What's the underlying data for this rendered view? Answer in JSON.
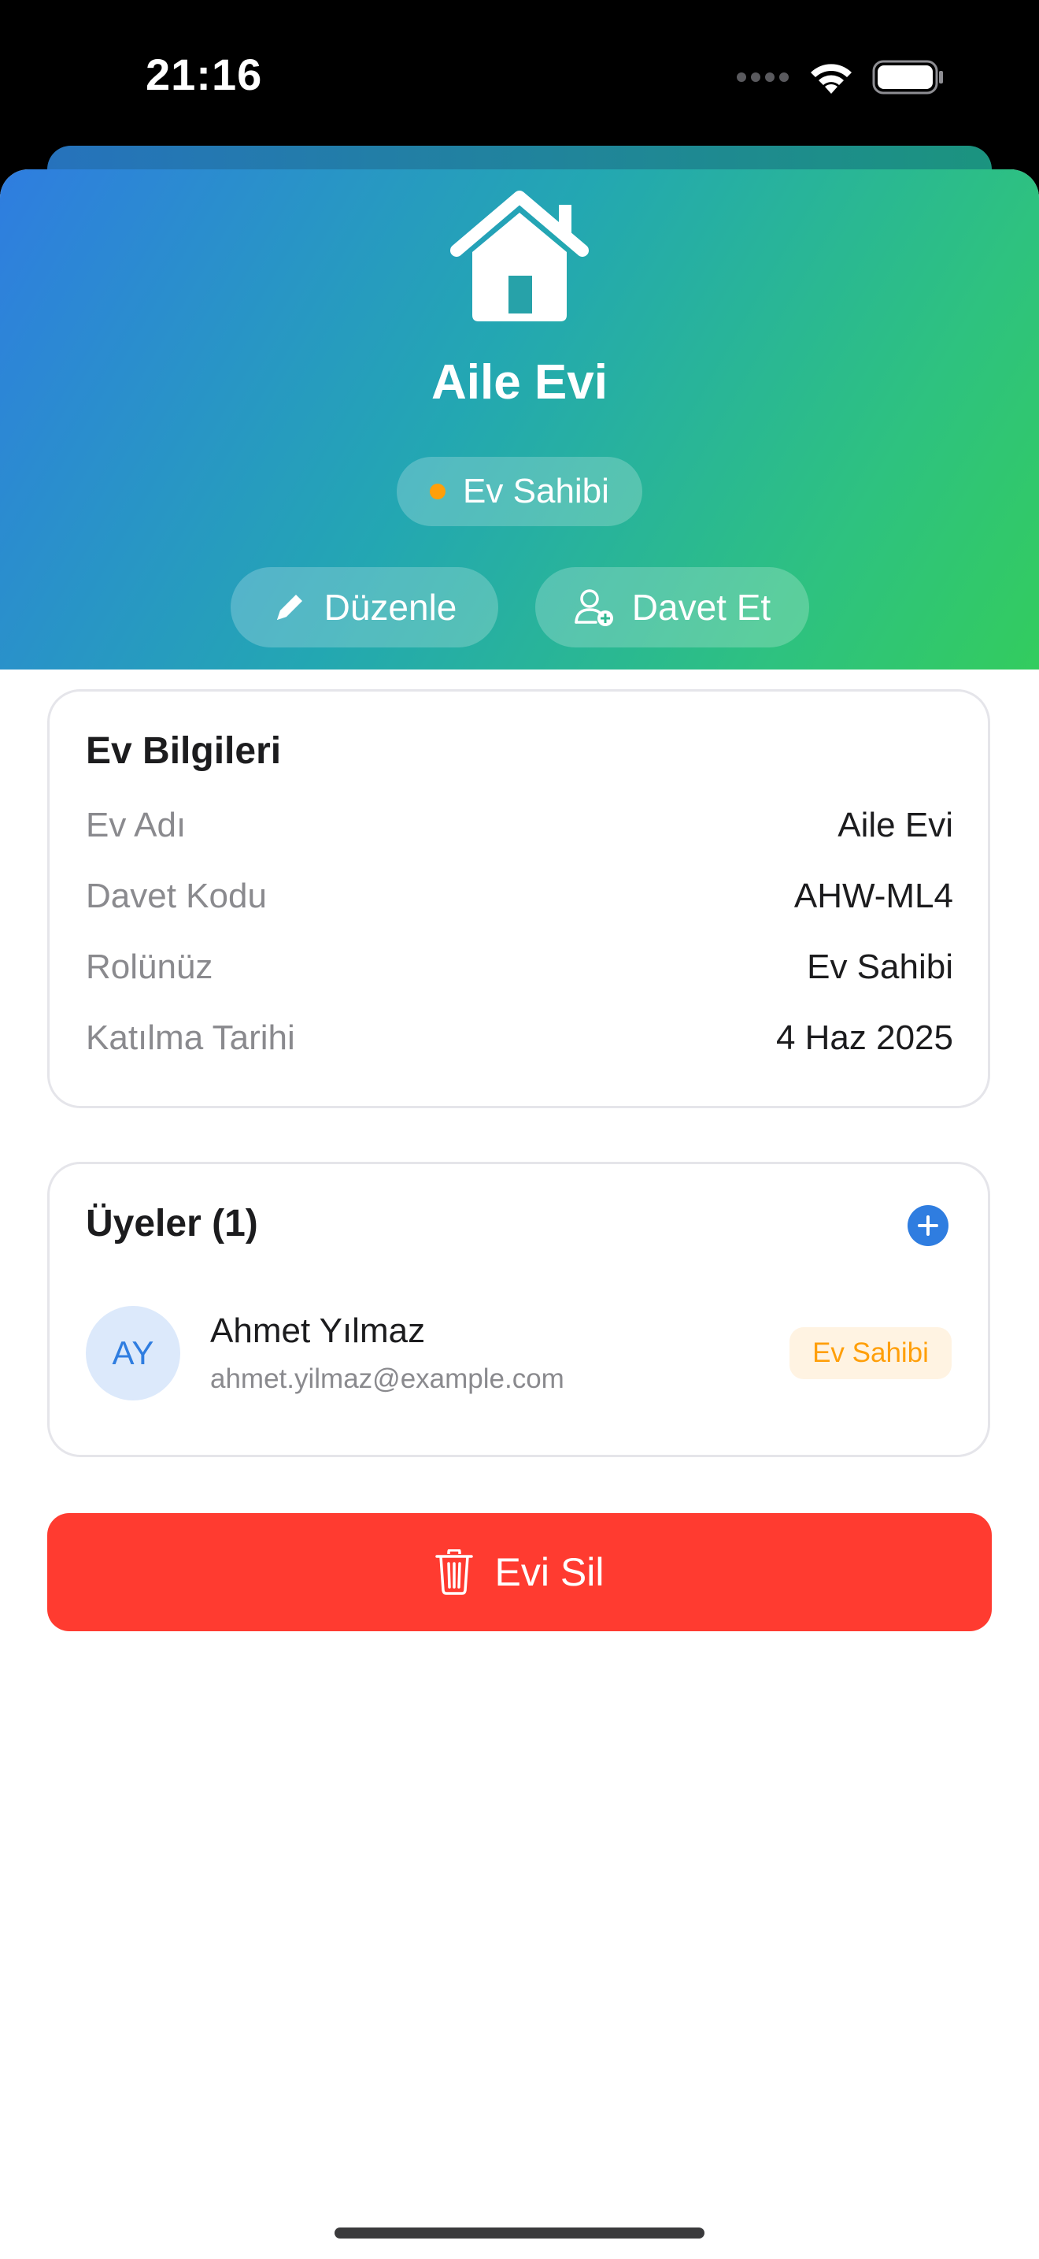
{
  "status_bar": {
    "time": "21:16"
  },
  "hero": {
    "icon": "house-icon",
    "title": "Aile Evi",
    "role_badge": "Ev Sahibi",
    "role_dot_color": "#ff9f0a",
    "edit_label": "Düzenle",
    "edit_icon": "pencil-icon",
    "invite_label": "Davet Et",
    "invite_icon": "person-add-icon"
  },
  "info_card": {
    "title": "Ev Bilgileri",
    "rows": [
      {
        "label": "Ev Adı",
        "value": "Aile Evi"
      },
      {
        "label": "Davet Kodu",
        "value": "AHW-ML4"
      },
      {
        "label": "Rolünüz",
        "value": "Ev Sahibi"
      },
      {
        "label": "Katılma Tarihi",
        "value": "4 Haz 2025"
      }
    ]
  },
  "members_card": {
    "title": "Üyeler (1)",
    "add_icon": "plus-circle-icon",
    "members": [
      {
        "initials": "AY",
        "name": "Ahmet Yılmaz",
        "email": "ahmet.yilmaz@example.com",
        "role": "Ev Sahibi"
      }
    ]
  },
  "delete_button": {
    "label": "Evi Sil",
    "icon": "trash-icon",
    "color": "#ff3b30"
  },
  "colors": {
    "accent": "#2f7de0",
    "gradient_start": "#2f7de0",
    "gradient_end": "#33cc5e",
    "owner_orange": "#ff9f0a"
  }
}
